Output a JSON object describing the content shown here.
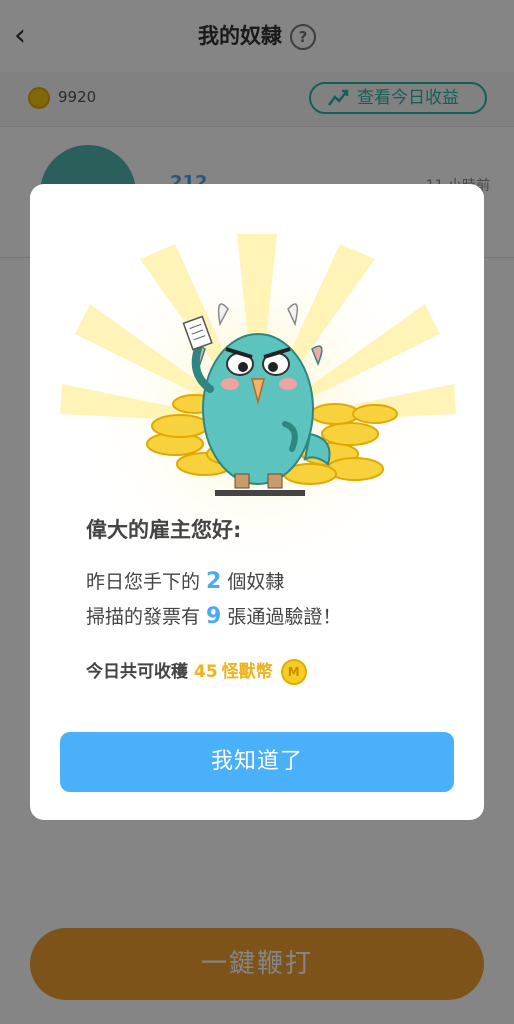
{
  "header": {
    "title": "我的奴隸",
    "back_glyph": "‹",
    "help_glyph": "?"
  },
  "wallet": {
    "balance": "9920",
    "earnings_label": "查看今日收益"
  },
  "list": [
    {
      "name": "212",
      "time": "11 小時前"
    }
  ],
  "whip_button": {
    "label": "一鍵鞭打"
  },
  "modal": {
    "greeting": "偉大的雇主您好:",
    "line1_prefix": "昨日您手下的",
    "slaves_count": "2",
    "line1_suffix": "個奴隸",
    "line2_prefix": "掃描的發票有",
    "invoices_count": "9",
    "line2_suffix": "張通過驗證！",
    "harvest_prefix": "今日共可收穫",
    "harvest_amount": "45",
    "harvest_unit": "怪獸幣",
    "coin_letter": "M",
    "confirm_label": "我知道了"
  },
  "colors": {
    "accent_blue": "#4ab0fa",
    "teal": "#27b8a8",
    "gold": "#f0b21a",
    "whip_orange": "#f0a030"
  }
}
